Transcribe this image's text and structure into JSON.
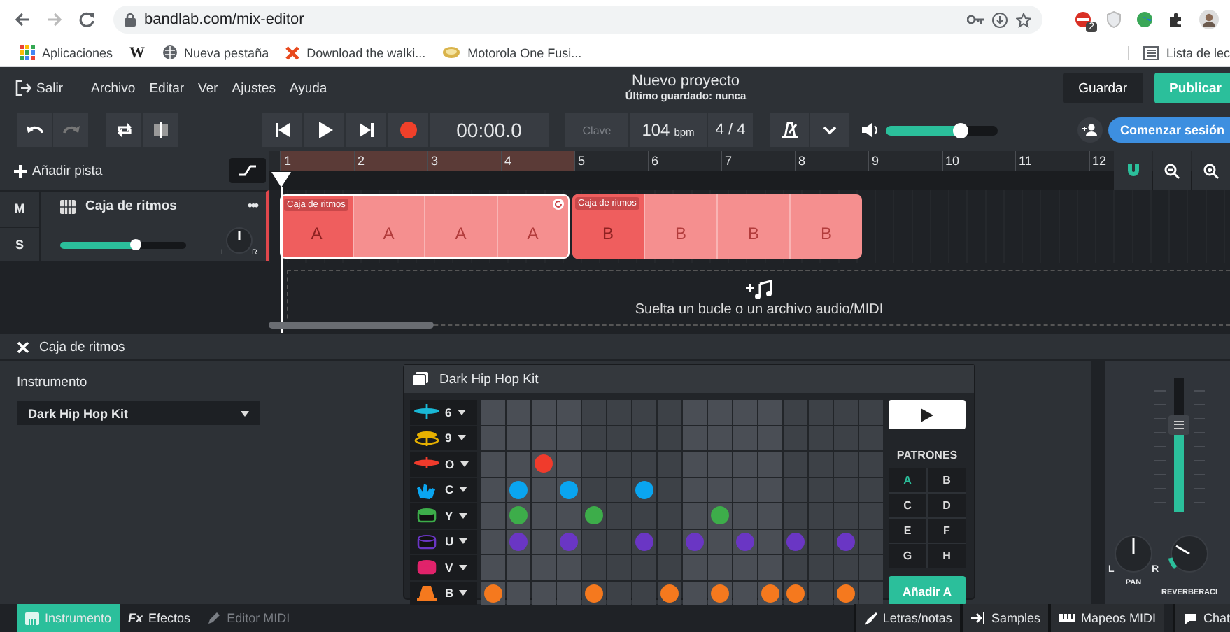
{
  "browser": {
    "url": "bandlab.com/mix-editor",
    "extension_badge": "2",
    "bookmarks": [
      {
        "kind": "apps",
        "label": "Aplicaciones"
      },
      {
        "kind": "letter",
        "label": "W"
      },
      {
        "kind": "globe",
        "label": "Nueva pestaña"
      },
      {
        "kind": "x",
        "label": "Download the walki..."
      },
      {
        "kind": "oval",
        "label": "Motorola One Fusi..."
      }
    ],
    "reading_list": "Lista de lec"
  },
  "menu": {
    "exit": "Salir",
    "items": [
      "Archivo",
      "Editar",
      "Ver",
      "Ajustes",
      "Ayuda"
    ]
  },
  "project": {
    "title": "Nuevo proyecto",
    "subtitle": "Último guardado: nunca"
  },
  "actions": {
    "save": "Guardar",
    "publish": "Publicar"
  },
  "toolbar": {
    "redo": {
      "disabled": true
    },
    "time": "00:00.0",
    "key": {
      "label": "Clave",
      "disabled": true
    },
    "tempo": "104",
    "tempo_unit": "bpm",
    "signature": "4 / 4",
    "volume": {
      "level": 0.68
    },
    "session": "Comenzar sesión"
  },
  "tracks_panel": {
    "add_track": "Añadir pista",
    "ruler": [
      {
        "label": "1",
        "in_loop": true
      },
      {
        "label": "2",
        "in_loop": true
      },
      {
        "label": "3",
        "in_loop": true
      },
      {
        "label": "4",
        "in_loop": true
      },
      {
        "label": "5",
        "in_loop": false
      },
      {
        "label": "6",
        "in_loop": false
      },
      {
        "label": "7",
        "in_loop": false
      },
      {
        "label": "8",
        "in_loop": false
      },
      {
        "label": "9",
        "in_loop": false
      },
      {
        "label": "10",
        "in_loop": false
      },
      {
        "label": "11",
        "in_loop": false
      },
      {
        "label": "12",
        "in_loop": false
      }
    ],
    "tracks": [
      {
        "name": "Caja de ritmos",
        "mute": "M",
        "solo": "S",
        "more": "•••",
        "volume": {
          "level": 0.6
        },
        "pan_left": "L",
        "pan_right": "R",
        "clips": [
          {
            "label": "Caja de ritmos",
            "looped": true,
            "cells": [
              {
                "label": "A",
                "active": true
              },
              {
                "label": "A",
                "active": false
              },
              {
                "label": "A",
                "active": false
              },
              {
                "label": "A",
                "active": false
              }
            ]
          },
          {
            "label": "Caja de ritmos",
            "looped": false,
            "cells": [
              {
                "label": "B",
                "active": true
              },
              {
                "label": "B",
                "active": false
              },
              {
                "label": "B",
                "active": false
              },
              {
                "label": "B",
                "active": false
              }
            ]
          }
        ]
      }
    ],
    "drop_hint": "Suelta un bucle o un archivo audio/MIDI"
  },
  "instrument_panel": {
    "title": "Caja de ritmos",
    "label": "Instrumento",
    "selected_kit": "Dark Hip Hop Kit"
  },
  "drum_machine": {
    "title": "Dark Hip Hop Kit",
    "rows": [
      {
        "key": "6",
        "kind": "hat",
        "color": "#19b8d6",
        "steps": [
          false,
          false,
          false,
          false,
          false,
          false,
          false,
          false,
          false,
          false,
          false,
          false,
          false,
          false,
          false,
          false
        ]
      },
      {
        "key": "9",
        "kind": "crash",
        "color": "#e6b000",
        "steps": [
          false,
          false,
          false,
          false,
          false,
          false,
          false,
          false,
          false,
          false,
          false,
          false,
          false,
          false,
          false,
          false
        ]
      },
      {
        "key": "O",
        "kind": "ride",
        "color": "#f03b2c",
        "steps": [
          false,
          false,
          true,
          false,
          false,
          false,
          false,
          false,
          false,
          false,
          false,
          false,
          false,
          false,
          false,
          false
        ]
      },
      {
        "key": "C",
        "kind": "clap",
        "color": "#0aa5f0",
        "steps": [
          false,
          true,
          false,
          true,
          false,
          false,
          true,
          false,
          false,
          false,
          false,
          false,
          false,
          false,
          false,
          false
        ]
      },
      {
        "key": "Y",
        "kind": "tom",
        "color": "#3dad4a",
        "steps": [
          false,
          true,
          false,
          false,
          true,
          false,
          false,
          false,
          false,
          true,
          false,
          false,
          false,
          false,
          false,
          false
        ]
      },
      {
        "key": "U",
        "kind": "kick",
        "color": "#6a36c4",
        "steps": [
          false,
          true,
          false,
          true,
          false,
          false,
          true,
          false,
          true,
          false,
          true,
          false,
          true,
          false,
          true,
          false
        ]
      },
      {
        "key": "V",
        "kind": "snare",
        "color": "#e0236b",
        "steps": [
          false,
          false,
          false,
          false,
          false,
          false,
          false,
          false,
          false,
          false,
          false,
          false,
          false,
          false,
          false,
          false
        ]
      },
      {
        "key": "B",
        "kind": "cowbell",
        "color": "#f5791e",
        "steps": [
          true,
          false,
          false,
          false,
          true,
          false,
          false,
          true,
          false,
          true,
          false,
          true,
          true,
          false,
          true,
          false
        ]
      }
    ],
    "patterns_title": "PATRONES",
    "patterns": [
      {
        "label": "A",
        "selected": true
      },
      {
        "label": "B",
        "selected": false
      },
      {
        "label": "C",
        "selected": false
      },
      {
        "label": "D",
        "selected": false
      },
      {
        "label": "E",
        "selected": false
      },
      {
        "label": "F",
        "selected": false
      },
      {
        "label": "G",
        "selected": false
      },
      {
        "label": "H",
        "selected": false
      }
    ],
    "add_button": "Añadir A"
  },
  "mixer": {
    "fader": {
      "level": 0.65
    },
    "pan_label": "PAN",
    "pan_left": "L",
    "pan_right": "R",
    "reverb_label": "REVERBERACI"
  },
  "bottom_tabs": [
    {
      "label": "Instrumento",
      "kind": "icon",
      "selected": true,
      "disabled": false
    },
    {
      "label": "Efectos",
      "kind": "text",
      "prefix": "Fx",
      "selected": false,
      "disabled": false
    },
    {
      "label": "Editor MIDI",
      "kind": "icon",
      "selected": false,
      "disabled": true
    }
  ],
  "side_tabs": [
    {
      "label": "Letras/notas",
      "kind": "pen"
    },
    {
      "label": "Samples",
      "kind": "samples"
    },
    {
      "label": "Mapeos MIDI",
      "kind": "keys"
    },
    {
      "label": "Chat",
      "kind": "chat"
    }
  ]
}
